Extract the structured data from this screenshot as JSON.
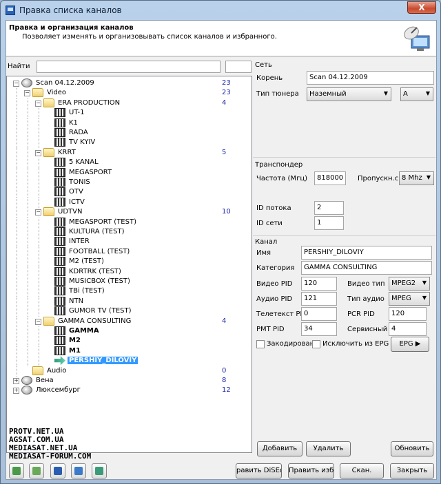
{
  "window": {
    "title": "Правка списка каналов",
    "close_glyph": "X"
  },
  "header": {
    "title": "Правка и организация каналов",
    "description": "Позволяет изменять и организовывать список каналов и избранного."
  },
  "search": {
    "label": "Найти",
    "value": ""
  },
  "tree": [
    {
      "label": "Scan 04.12.2009",
      "count": "23",
      "icon": "satellite-dish-icon",
      "level": 0,
      "expander": "−"
    },
    {
      "label": "Video",
      "count": "23",
      "icon": "folder-icon",
      "level": 1,
      "expander": "−"
    },
    {
      "label": "ERA PRODUCTION",
      "count": "4",
      "icon": "folder-icon",
      "level": 2,
      "expander": "−"
    },
    {
      "label": "UT-1",
      "icon": "tv-channel-icon",
      "level": 3
    },
    {
      "label": "K1",
      "icon": "tv-channel-icon",
      "level": 3
    },
    {
      "label": "RADA",
      "icon": "tv-channel-icon",
      "level": 3
    },
    {
      "label": "TV KYIV",
      "icon": "tv-channel-icon",
      "level": 3
    },
    {
      "label": "KRRT",
      "count": "5",
      "icon": "folder-icon",
      "level": 2,
      "expander": "−"
    },
    {
      "label": "5 KANAL",
      "icon": "tv-channel-icon",
      "level": 3
    },
    {
      "label": "MEGASPORT",
      "icon": "tv-channel-icon",
      "level": 3
    },
    {
      "label": "TONIS",
      "icon": "tv-channel-icon",
      "level": 3
    },
    {
      "label": "OTV",
      "icon": "tv-channel-icon",
      "level": 3
    },
    {
      "label": "ICTV",
      "icon": "tv-channel-icon",
      "level": 3
    },
    {
      "label": "UDTVN",
      "count": "10",
      "icon": "folder-icon",
      "level": 2,
      "expander": "−"
    },
    {
      "label": "MEGASPORT (TEST)",
      "icon": "tv-channel-icon",
      "level": 3
    },
    {
      "label": "KULTURA (TEST)",
      "icon": "tv-channel-icon",
      "level": 3
    },
    {
      "label": "INTER",
      "icon": "tv-channel-icon",
      "level": 3
    },
    {
      "label": "FOOTBALL (TEST)",
      "icon": "tv-channel-icon",
      "level": 3
    },
    {
      "label": "M2 (TEST)",
      "icon": "tv-channel-icon",
      "level": 3
    },
    {
      "label": "KDRTRK (TEST)",
      "icon": "tv-channel-icon",
      "level": 3
    },
    {
      "label": "MUSICBOX (TEST)",
      "icon": "tv-channel-icon",
      "level": 3
    },
    {
      "label": "TBi (TEST)",
      "icon": "tv-channel-icon",
      "level": 3
    },
    {
      "label": "NTN",
      "icon": "tv-channel-icon",
      "level": 3
    },
    {
      "label": "GUMOR TV (TEST)",
      "icon": "tv-channel-icon",
      "level": 3
    },
    {
      "label": "GAMMA CONSULTING",
      "count": "4",
      "icon": "folder-icon",
      "level": 2,
      "expander": "−"
    },
    {
      "label": "GAMMA",
      "icon": "tv-channel-icon",
      "level": 3,
      "bold": true
    },
    {
      "label": "M2",
      "icon": "tv-channel-icon",
      "level": 3,
      "bold": true
    },
    {
      "label": "M1",
      "icon": "tv-channel-icon",
      "level": 3,
      "bold": true
    },
    {
      "label": "PERSHIY_DILOVIY",
      "icon": "arrow-right-icon",
      "level": 3,
      "selected": true
    },
    {
      "label": "Audio",
      "count": "0",
      "icon": "folder-icon",
      "level": 1
    },
    {
      "label": "Вена",
      "count": "8",
      "icon": "satellite-dish-icon",
      "level": 0,
      "expander": "+"
    },
    {
      "label": "Люксембург",
      "count": "12",
      "icon": "satellite-dish-icon",
      "level": 0,
      "expander": "+"
    }
  ],
  "watermark": [
    "PROTV.NET.UA",
    "AGSAT.COM.UA",
    "MEDIASAT.NET.UA",
    "MEDIASAT-FORUM.COM"
  ],
  "network": {
    "title": "Сеть",
    "root_label": "Корень",
    "root_value": "Scan 04.12.2009",
    "tuner_label": "Тип тюнера",
    "tuner_value": "Наземный",
    "tuner_sub_value": "A"
  },
  "transponder": {
    "title": "Транспондер",
    "freq_label": "Частота (Мгц)",
    "freq_value": "818000",
    "bandwidth_label": "Пропускн.спо",
    "bandwidth_value": "8 Mhz",
    "stream_id_label": "ID потока",
    "stream_id_value": "2",
    "network_id_label": "ID сети",
    "network_id_value": "1"
  },
  "channel": {
    "title": "Канал",
    "name_label": "Имя",
    "name_value": "PERSHIY_DILOVIY",
    "category_label": "Категория",
    "category_value": "GAMMA CONSULTING",
    "video_pid_label": "Видео PID",
    "video_pid_value": "120",
    "video_type_label": "Видео тип",
    "video_type_value": "MPEG2",
    "audio_pid_label": "Аудио PID",
    "audio_pid_value": "121",
    "audio_type_label": "Тип аудио",
    "audio_type_value": "MPEG",
    "teletext_label": "Телетекст PID",
    "teletext_value": "0",
    "pcr_label": "PCR PID",
    "pcr_value": "120",
    "pmt_label": "PMT PID",
    "pmt_value": "34",
    "service_label": "Сервисный P",
    "service_value": "4",
    "encrypted_label": "Закодирован",
    "exclude_epg_label": "Исключить из EPG",
    "epg_button": "EPG"
  },
  "actions": {
    "add": "Добавить",
    "delete": "Удалить",
    "refresh": "Обновить"
  },
  "bottom": {
    "diseqc": "равить DiSEqc",
    "fav": "Править избр.",
    "scan": "Скан.",
    "close": "Закрыть"
  },
  "colors": {
    "selection": "#3399ff",
    "count_text": "#1a24a8",
    "title_bar": "#b9d1ea"
  }
}
